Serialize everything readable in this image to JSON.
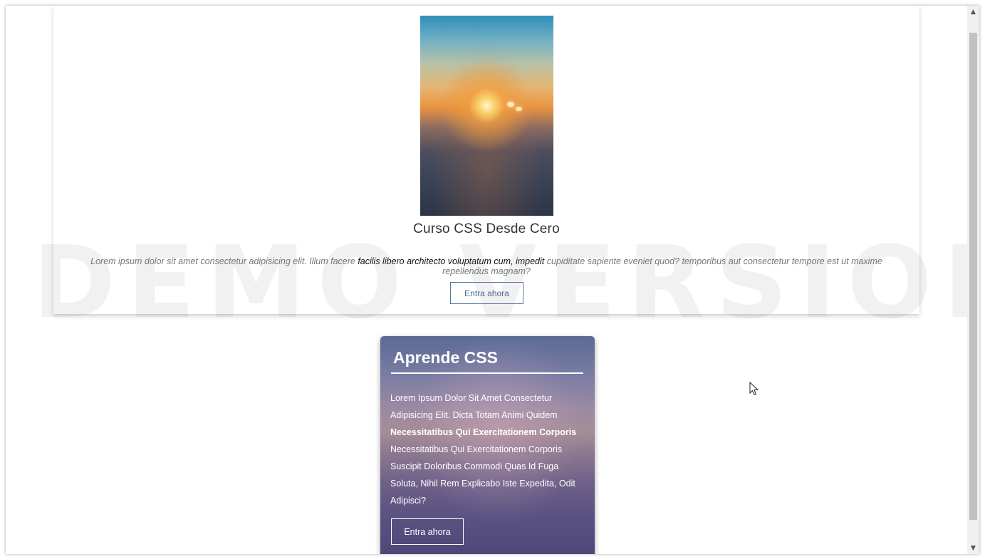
{
  "course_card": {
    "title": "Curso CSS Desde Cero",
    "desc_start": "Lorem ipsum dolor sit amet consectetur adipisicing elit. Illum facere ",
    "desc_bold": "facilis libero architecto voluptatum cum, impedit",
    "desc_end": " cupiditate sapiente eveniet quod? temporibus aut consectetur tempore est ut maxime repellendus magnam?",
    "button_label": "Entra ahora"
  },
  "watermark": "DEMO VERSION",
  "feature_card": {
    "title": "Aprende CSS",
    "text_line1": "Lorem Ipsum Dolor Sit Amet Consectetur Adipisicing Elit. Dicta Totam Animi Quidem",
    "text_bold": "Necessitatibus Qui Exercitationem Corporis",
    "text_line2": "Necessitatibus Qui Exercitationem Corporis Suscipit Doloribus Commodi Quas Id Fuga Soluta, Nihil Rem Explicabo Iste Expedita, Odit Adipisci?",
    "button_label": "Entra ahora"
  },
  "icons": {
    "scroll_up": "arrow-up-icon",
    "scroll_down": "arrow-down-icon",
    "cursor": "mouse-pointer-icon"
  }
}
